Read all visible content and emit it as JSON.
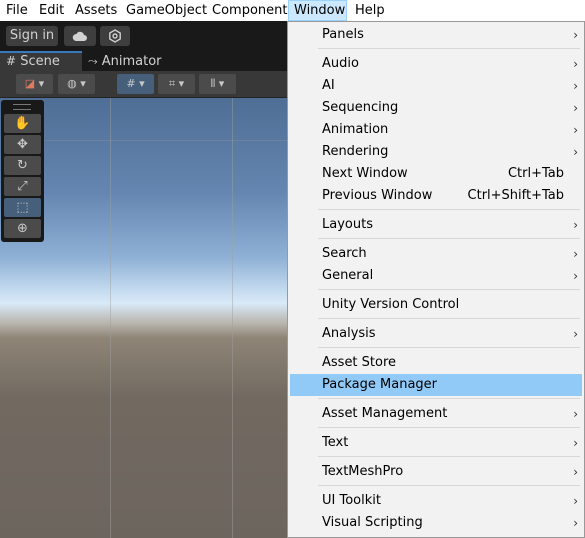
{
  "menubar": {
    "items": [
      "File",
      "Edit",
      "Assets",
      "GameObject",
      "Component",
      "Window",
      "Help"
    ]
  },
  "toolbar": {
    "sign_in_label": "Sign in"
  },
  "tabs": {
    "scene": "Scene",
    "animator": "Animator"
  },
  "window_menu": {
    "panels": "Panels",
    "audio": "Audio",
    "ai": "AI",
    "sequencing": "Sequencing",
    "animation": "Animation",
    "rendering": "Rendering",
    "next_window": "Next Window",
    "next_window_shortcut": "Ctrl+Tab",
    "previous_window": "Previous Window",
    "previous_window_shortcut": "Ctrl+Shift+Tab",
    "layouts": "Layouts",
    "search": "Search",
    "general": "General",
    "unity_version_control": "Unity Version Control",
    "analysis": "Analysis",
    "asset_store": "Asset Store",
    "package_manager": "Package Manager",
    "asset_management": "Asset Management",
    "text": "Text",
    "textmeshpro": "TextMeshPro",
    "ui_toolkit": "UI Toolkit",
    "visual_scripting": "Visual Scripting",
    "highlighted_item": "Package Manager",
    "submenu_arrow": "›"
  },
  "colors": {
    "menu_highlight": "#91c9f7",
    "menubar_active": "#cce8ff",
    "selected_tool": "#46607c",
    "tab_accent": "#3a79bb"
  },
  "icons": [
    "cloud-icon",
    "settings-icon",
    "scene-grid-icon",
    "animator-icon",
    "hand-tool-icon",
    "move-tool-icon",
    "rotate-tool-icon",
    "scale-tool-icon",
    "rect-tool-icon",
    "transform-tool-icon"
  ]
}
